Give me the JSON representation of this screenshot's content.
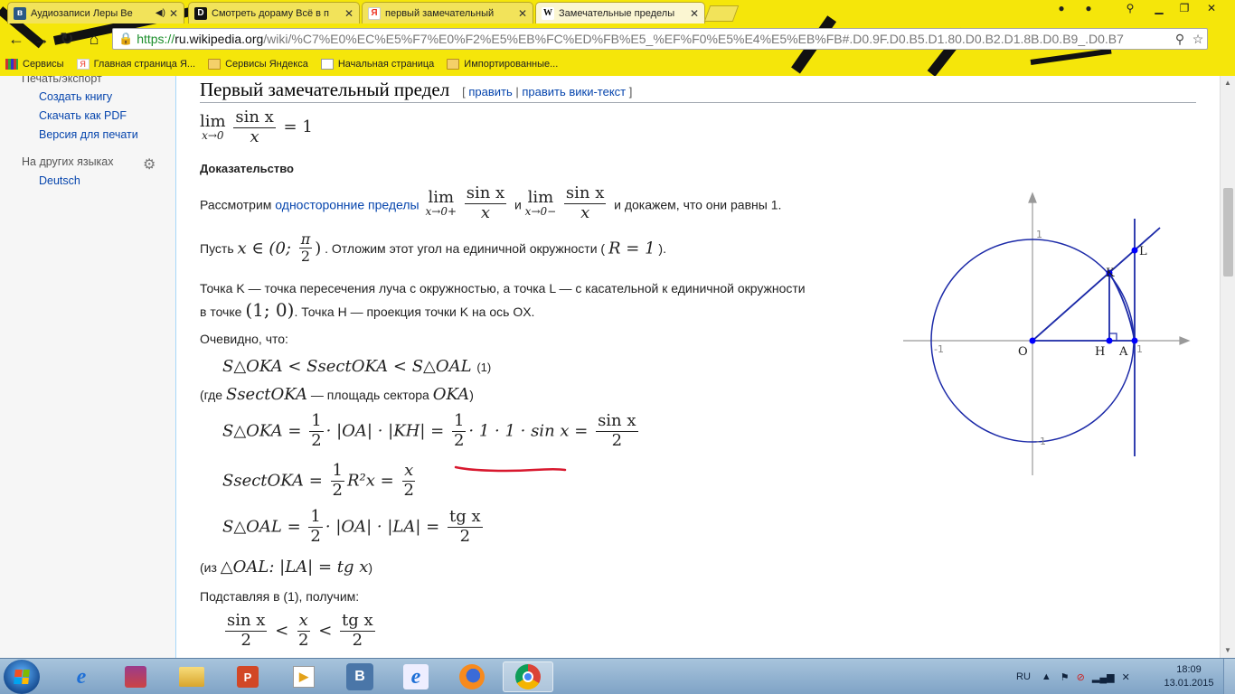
{
  "browser": {
    "tabs": [
      {
        "title": "Аудиозаписи Леры Ве",
        "audio_icon": "◀)"
      },
      {
        "title": "Смотреть дораму Всё в п"
      },
      {
        "title": "первый замечательный"
      },
      {
        "title": "Замечательные пределы",
        "active": true
      }
    ],
    "url": {
      "scheme": "https://",
      "host": "ru.wikipedia.org",
      "path": "/wiki/%C7%E0%EC%E5%F7%E0%F2%E5%EB%FC%ED%FB%E5_%EF%F0%E5%E4%E5%EB%FB#.D0.9F.D0.B5.D1.80.D0.B2.D1.8B.D0.B9_.D0.B7"
    },
    "bookmarks": [
      "Сервисы",
      "Главная страница Я...",
      "Сервисы Яндекса",
      "Начальная страница",
      "Импортированные..."
    ]
  },
  "sidebar": {
    "section_print": "Печать/экспорт",
    "print_links": [
      "Создать книгу",
      "Скачать как PDF",
      "Версия для печати"
    ],
    "section_lang": "На других языках",
    "lang_links": [
      "Deutsch"
    ]
  },
  "article": {
    "heading": "Первый замечательный предел",
    "edit_open": "[ ",
    "edit": "править",
    "edit_sep": " | ",
    "edit_wiki": "править вики-текст",
    "edit_close": " ]",
    "formula_main": {
      "lim": "lim",
      "sub": "x→0",
      "num": "sin x",
      "den": "x",
      "rhs": "= 1"
    },
    "proof_title": "Доказательство",
    "p1_a": "Рассмотрим ",
    "p1_link": "односторонние пределы",
    "p1_lim1_sub": "x→0+",
    "p1_and": " и ",
    "p1_lim2_sub": "x→0−",
    "p1_b": " и докажем, что они равны 1.",
    "p2_a": "Пусть ",
    "p2_x": "x ∈ (0; ",
    "p2_pi": "π",
    "p2_2": "2",
    "p2_close": ")",
    "p2_b": ". Отложим этот угол на единичной окружности (",
    "p2_r": "R = 1",
    "p2_c": ").",
    "p3_line1": "Точка K — точка пересечения луча с окружностью, а точка L — с касательной к единичной окружности",
    "p3_a": "в точке ",
    "p3_pt": "(1; 0)",
    "p3_b": ". Точка H — проекция точки K на ось OX.",
    "p4": "Очевидно, что:",
    "ineq1": "S△OKA < SsectOKA < S△OAL",
    "ineq1_ref": "(1)",
    "where_a": "(где ",
    "where_s": "SsectOKA",
    "where_b": " — площадь сектора ",
    "where_oka": "OKA",
    "where_c": ")",
    "eq1_lhs": "S△OKA = ",
    "eq1_mid": "· |OA| · |KH| = ",
    "eq1_mid2": "· 1 · 1 · sin x = ",
    "eq1_num": "sin x",
    "eq2_lhs": "SsectOKA = ",
    "eq2_mid": "R²x = ",
    "eq2_num": "x",
    "eq3_lhs": "S△OAL = ",
    "eq3_mid": "· |OA| · |LA| = ",
    "eq3_num": "tg x",
    "half_num": "1",
    "den2": "2",
    "from_a": "(из ",
    "from_t": "△OAL",
    "from_eq": ": |LA| = tg x",
    "from_c": ")",
    "p5": "Подставляя в (1), получим:",
    "final_lt": "<",
    "final_sin": "sin x",
    "final_x": "x",
    "final_tg": "tg x"
  },
  "diagram": {
    "labels": {
      "O": "O",
      "H": "H",
      "A": "A",
      "K": "K",
      "L": "L"
    },
    "ticks": {
      "one_y": "1",
      "one_x": "1",
      "neg_one_x": "-1",
      "neg_one_y": "-1"
    },
    "colors": {
      "circle": "#1c2aa8",
      "axis": "#999999",
      "points": "#0000ff",
      "underline": "#d8182e"
    }
  },
  "taskbar": {
    "lang": "RU",
    "time": "18:09",
    "date": "13.01.2015",
    "apps": [
      "internet-explorer",
      "winrar",
      "explorer",
      "powerpoint",
      "media-player",
      "vk",
      "internet-explorer-2",
      "firefox",
      "chrome"
    ]
  }
}
